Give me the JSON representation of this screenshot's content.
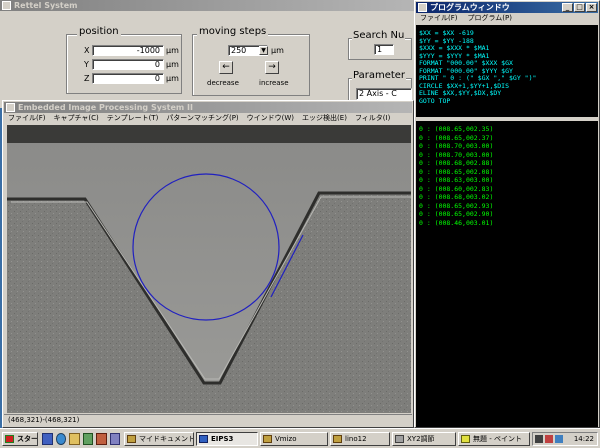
{
  "desktop": {
    "background": "#3a6ea5"
  },
  "main_window": {
    "title": "Rettel System",
    "position_group": {
      "title": "position",
      "axes": [
        {
          "label": "X",
          "value": "-1000",
          "unit": "μm"
        },
        {
          "label": "Y",
          "value": "0",
          "unit": "μm"
        },
        {
          "label": "Z",
          "value": "0",
          "unit": "μm"
        }
      ]
    },
    "moving_steps_group": {
      "title": "moving steps",
      "step_value": "250",
      "unit": "μm",
      "decrease_button": "←",
      "increase_button": "→",
      "decrease_label": "decrease",
      "increase_label": "increase"
    },
    "search_group": {
      "title": "Search Nu",
      "value": "1"
    },
    "parameter_group": {
      "title": "Parameter",
      "value": "2 Axis - C"
    }
  },
  "program_window": {
    "title": "プログラムウィンドウ",
    "menu": [
      "ファイル(F)",
      "プログラム(P)"
    ],
    "code_lines": [
      "$XX = $XX -619",
      "$YY = $YY -188",
      "$XXX = $XXX * $MA1",
      "$YYY = $YYY * $MA1",
      "FORMAT \"000.00\" $XXX $GX",
      "FORMAT \"000.00\" $YYY $GY",
      "PRINT \" 0 : (\" $GX \",\" $GY \")\"",
      "CIRCLE $XX+1,$YY+1,$DIS",
      "ELINE $XX,$YY,$DX,$DY",
      "GOTO TOP"
    ],
    "output_lines": [
      "0 : (008.65,002.35)",
      "0 : (008.65,002.37)",
      "0 : (008.70,003.00)",
      "0 : (008.70,003.00)",
      "0 : (008.68,002.88)",
      "0 : (008.65,002.08)",
      "0 : (008.63,003.00)",
      "0 : (008.60,002.83)",
      "0 : (008.68,003.02)",
      "0 : (008.65,002.93)",
      "0 : (008.65,002.90)",
      "0 : (008.46,003.01)"
    ]
  },
  "image_window": {
    "title": "Embedded Image Processing System II",
    "menu": [
      "ファイル(F)",
      "キャプチャ(C)",
      "テンプレート(T)",
      "パターンマッチング(P)",
      "ウインドウ(W)",
      "エッジ検出(E)",
      "フィルタ(I)"
    ],
    "status": "(468,321)-(468,321)"
  },
  "taskbar": {
    "start_label": "スタート",
    "tasks": [
      {
        "label": "マイドキュメント",
        "active": false
      },
      {
        "label": "EIPS3",
        "active": true
      },
      {
        "label": "Vmizo",
        "active": false
      },
      {
        "label": "lino12",
        "active": false
      },
      {
        "label": "XY2調節",
        "active": false
      },
      {
        "label": "無題 - ペイント",
        "active": false
      }
    ],
    "clock": "14:22"
  },
  "colors": {
    "titlebar_active": "#0a246a",
    "console_code_text": "#00ffff",
    "console_output_text": "#00ff00",
    "overlay_circle": "#2020c0"
  }
}
